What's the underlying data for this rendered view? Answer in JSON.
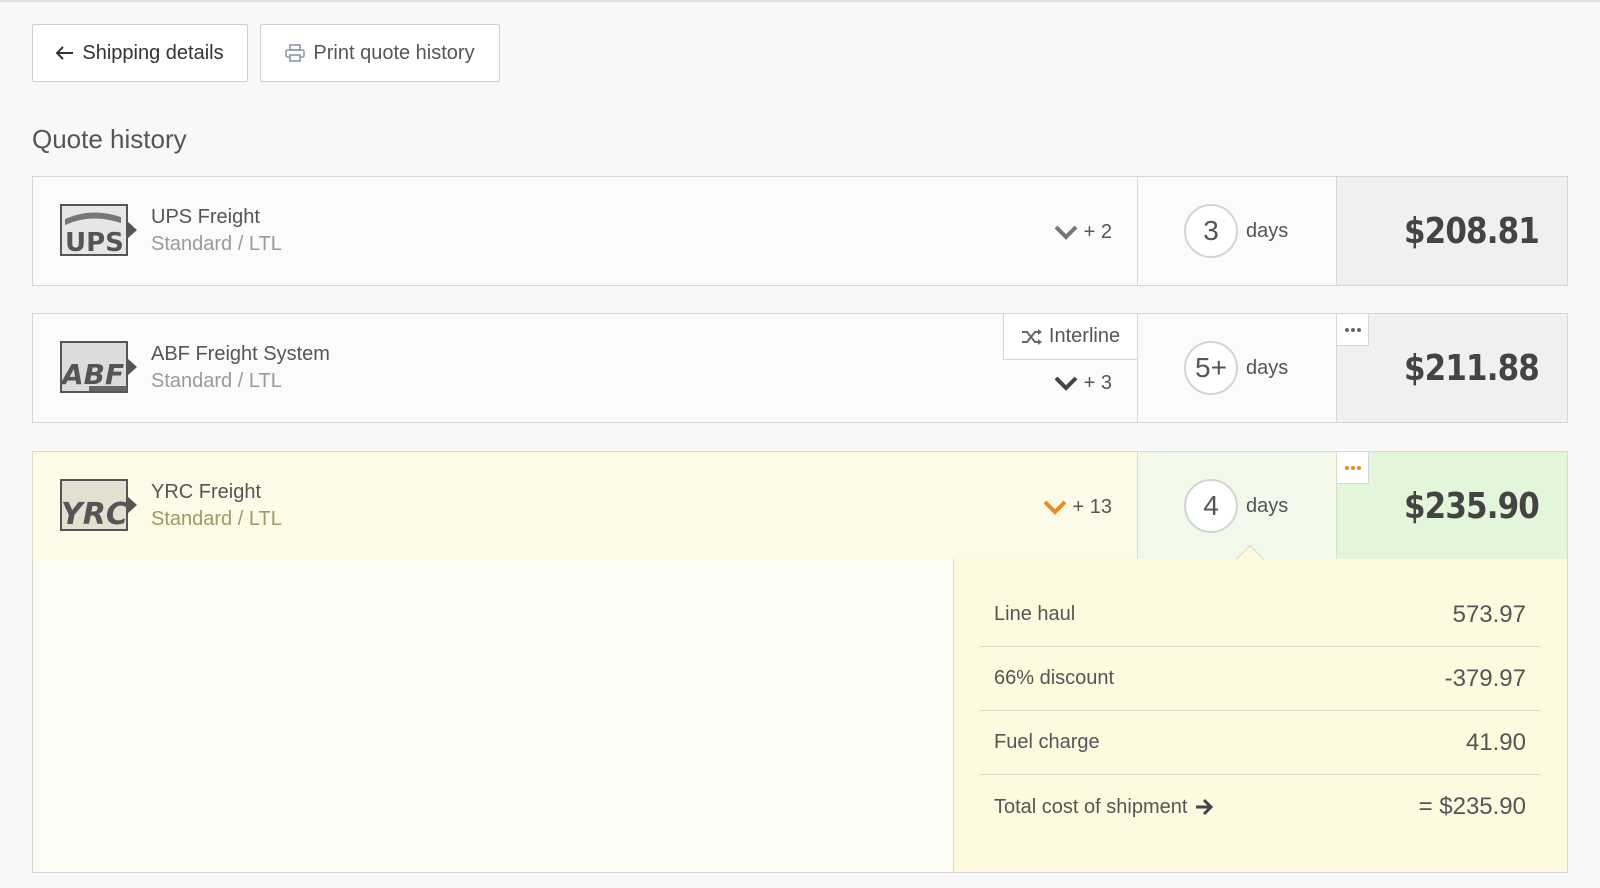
{
  "toolbar": {
    "back_label": "Shipping details",
    "print_label": "Print quote history"
  },
  "section_title": "Quote history",
  "quotes": [
    {
      "logo_text": "UPS",
      "carrier": "UPS Freight",
      "service": "Standard / LTL",
      "expand_count": "+ 2",
      "days": "3",
      "days_label": "days",
      "price": "$208.81"
    },
    {
      "logo_text": "ABF",
      "carrier": "ABF Freight System",
      "service": "Standard / LTL",
      "interline_label": "Interline",
      "expand_count": "+ 3",
      "days": "5+",
      "days_label": "days",
      "price": "$211.88"
    },
    {
      "logo_text": "YRC",
      "carrier": "YRC Freight",
      "service": "Standard / LTL",
      "expand_count": "+ 13",
      "days": "4",
      "days_label": "days",
      "price": "$235.90",
      "selected": true
    }
  ],
  "breakdown": {
    "rows": [
      {
        "label": "Line haul",
        "value": "573.97"
      },
      {
        "label": "66% discount",
        "value": "-379.97"
      },
      {
        "label": "Fuel charge",
        "value": "41.90"
      },
      {
        "label": "Total cost of shipment",
        "value": "= $235.90"
      }
    ]
  },
  "colors": {
    "accent_orange": "#f08a24",
    "selected_row_bg": "#fdfbe8",
    "selected_price_bg": "#e3f5da"
  }
}
